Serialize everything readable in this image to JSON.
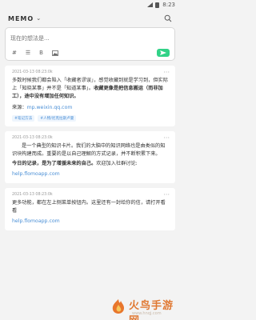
{
  "status": {
    "time": "8:23"
  },
  "app": {
    "title": "MEMO",
    "title_chevron": "⌄",
    "search_icon": "search-icon"
  },
  "composer": {
    "placeholder": "现在的想法是...",
    "tools": [
      "#",
      "☰",
      "B",
      "image-icon"
    ],
    "send_label": "send"
  },
  "memos": [
    {
      "timestamp": "2021-03-13 08:23:0k",
      "body_parts": [
        "多数时候我们都会陷入「收藏者谬误」，感觉收藏到就是学习到，但实际上「知晓某事」并不是「知道某事」。",
        "收藏更像是把信息搬运（而非加工），途中没有增加任何知识。"
      ],
      "source_label": "来源：",
      "source_link": "mp.weixin.qq.com",
      "tags": [
        "#笔记方法",
        "#人物/尼克拉斯卢曼"
      ]
    },
    {
      "timestamp": "2021-03-13 08:23:0k",
      "body_parts": [
        "是一个典型的知识卡片。我们的大脑中的知识网络也是由类似的知识块构建而成。重要的是以自己理解的方式记录，并不断积累下来。",
        "今日的记录，是为了增援未来的自己。",
        "欢迎加入社群讨论:"
      ],
      "link": "help.flomoapp.com"
    },
    {
      "timestamp": "2021-03-13 08:23:0k",
      "body_parts": [
        "更多功能，都在左上侧菜单按钮内。这里还有一封给你的信，请打开看看",
        "help.flomoapp.com"
      ]
    }
  ],
  "watermark": {
    "title": "火鸟手游网",
    "sub": "www.hnqj.com"
  }
}
